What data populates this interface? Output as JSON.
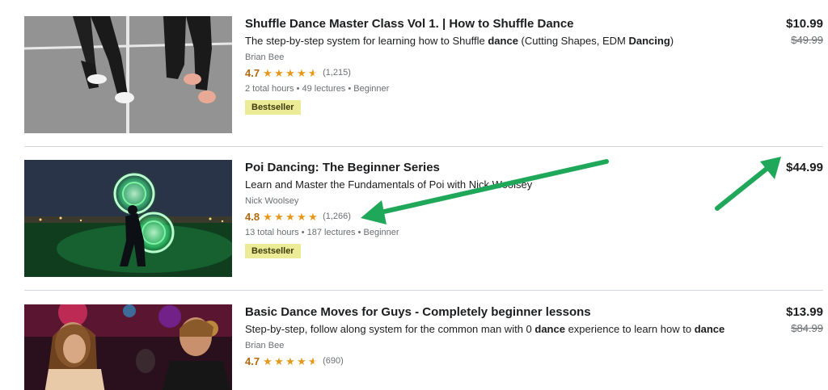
{
  "courses": [
    {
      "title": "Shuffle Dance Master Class Vol 1. | How to Shuffle Dance",
      "desc_parts": [
        "The step-by-step system for learning how to Shuffle ",
        "dance",
        " (Cutting Shapes, EDM ",
        "Dancing",
        ")"
      ],
      "author": "Brian Bee",
      "rating": "4.7",
      "rating_value": 4.7,
      "rating_count": "(1,215)",
      "meta": "2 total hours • 49 lectures • Beginner",
      "badge": "Bestseller",
      "price": "$10.99",
      "original_price": "$49.99"
    },
    {
      "title": "Poi Dancing: The Beginner Series",
      "desc_parts": [
        "Learn and Master the Fundamentals of Poi with Nick Woolsey"
      ],
      "author": "Nick Woolsey",
      "rating": "4.8",
      "rating_value": 4.8,
      "rating_count": "(1,266)",
      "meta": "13 total hours • 187 lectures • Beginner",
      "badge": "Bestseller",
      "price": "$44.99"
    },
    {
      "title": "Basic Dance Moves for Guys - Completely beginner lessons",
      "desc_parts": [
        "Step-by-step, follow along system for the common man with 0 ",
        "dance",
        " experience to learn how to ",
        "dance"
      ],
      "author": "Brian Bee",
      "rating": "4.7",
      "rating_value": 4.7,
      "rating_count": "(690)",
      "price": "$13.99",
      "original_price": "$84.99"
    }
  ],
  "colors": {
    "arrow": "#1fa75a",
    "rating": "#b4690e",
    "star": "#e59819",
    "badge_bg": "#eceb98"
  },
  "icons": {
    "star": "star-icon",
    "half_star": "star-half-icon"
  }
}
